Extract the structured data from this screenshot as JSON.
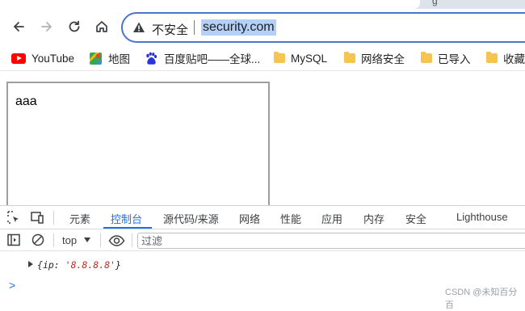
{
  "browser": {
    "tab_fragment": "g",
    "address": {
      "security_label": "不安全",
      "url": "security.com"
    },
    "bookmarks": [
      {
        "icon": "youtube-icon",
        "label": "YouTube"
      },
      {
        "icon": "maps-icon",
        "label": "地图"
      },
      {
        "icon": "baidu-icon",
        "label": "百度贴吧——全球..."
      },
      {
        "icon": "folder-icon",
        "label": "MySQL"
      },
      {
        "icon": "folder-icon",
        "label": "网络安全"
      },
      {
        "icon": "folder-icon",
        "label": "已导入"
      },
      {
        "icon": "folder-icon",
        "label": "收藏"
      }
    ]
  },
  "page": {
    "textarea_value": "aaa"
  },
  "devtools": {
    "tabs": [
      "元素",
      "控制台",
      "源代码/来源",
      "网络",
      "性能",
      "应用",
      "内存",
      "安全",
      "Lighthouse"
    ],
    "active_tab": "控制台",
    "context": "top",
    "filter_placeholder": "过滤",
    "console": {
      "open": "{",
      "key": "ip",
      "sep": ": ",
      "value": "'8.8.8.8'",
      "close": "}"
    },
    "prompt": ">"
  },
  "watermark": "CSDN @未知百分百",
  "colors": {
    "accent": "#1a73e8",
    "omnibox_border": "#4a76c8",
    "selection": "#b4d0f7",
    "string": "#c5221f"
  }
}
